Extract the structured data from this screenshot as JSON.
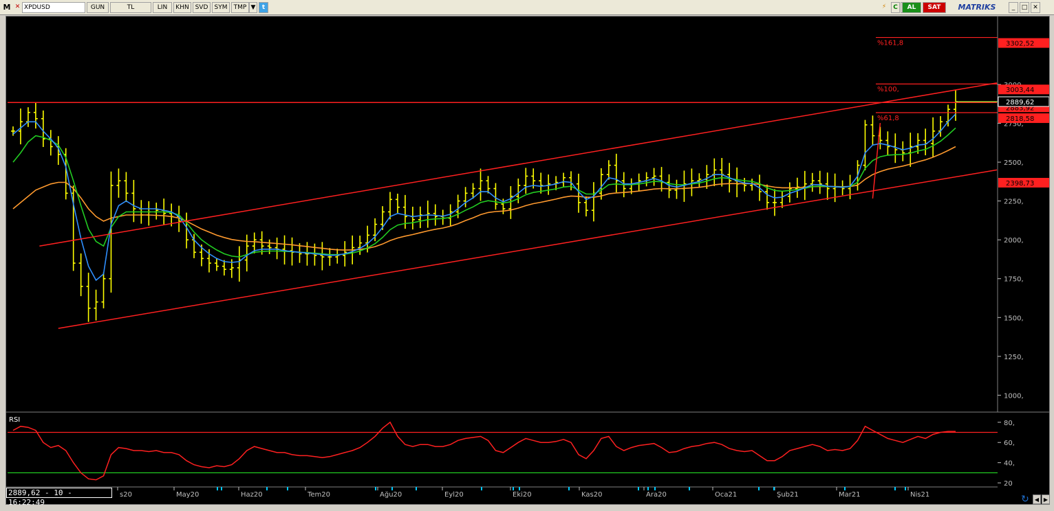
{
  "toolbar": {
    "logo": "M",
    "symbol": "XPDUSD",
    "buttons": [
      "GUN",
      "TL",
      "LIN",
      "KHN",
      "SVD",
      "SYM",
      "TMP"
    ],
    "buy_label": "AL",
    "sell_label": "SAT",
    "brand": "MATRIKS"
  },
  "chart_data": {
    "type": "line",
    "ylim": [
      900,
      3420
    ],
    "yticks": [
      "1000,",
      "1250,",
      "1500,",
      "1750,",
      "2000,",
      "2250,",
      "2500,",
      "2750,",
      "3000,"
    ],
    "ytick_values": [
      1000,
      1250,
      1500,
      1750,
      2000,
      2250,
      2500,
      2750,
      3000
    ],
    "xlabels": [
      "s20",
      "May20",
      "Haz20",
      "Tem20",
      "Ağu20",
      "Eyl20",
      "Eki20",
      "Kas20",
      "Ara20",
      "Oca21",
      "Şub21",
      "Mar21",
      "Nis21"
    ],
    "fibonacci": [
      {
        "label": "%161,8",
        "value": 3302.52,
        "value_label": "3302,52"
      },
      {
        "label": "%100,",
        "value": 3003.44,
        "value_label": "3003,44"
      },
      {
        "label": "%61,8",
        "value": 2818.58,
        "value_label": "2818,58"
      }
    ],
    "price_tags": [
      {
        "value": 2883.92,
        "label": "2883,92"
      },
      {
        "value": 2398.73,
        "label": "2398,73"
      }
    ],
    "last_price": {
      "value": 2889.62,
      "label": "2889,62"
    },
    "close": [
      2700,
      2760,
      2820,
      2780,
      2650,
      2600,
      2550,
      2300,
      1850,
      1700,
      1560,
      1600,
      1750,
      2350,
      2380,
      2300,
      2200,
      2160,
      2180,
      2190,
      2170,
      2150,
      2120,
      2000,
      1920,
      1880,
      1850,
      1830,
      1810,
      1820,
      1870,
      1960,
      2000,
      1960,
      1950,
      1940,
      1930,
      1920,
      1910,
      1910,
      1900,
      1890,
      1890,
      1900,
      1920,
      1950,
      1980,
      2030,
      2100,
      2180,
      2260,
      2210,
      2150,
      2130,
      2160,
      2170,
      2150,
      2140,
      2180,
      2250,
      2300,
      2330,
      2380,
      2330,
      2230,
      2200,
      2280,
      2350,
      2410,
      2380,
      2350,
      2360,
      2370,
      2400,
      2360,
      2240,
      2190,
      2300,
      2420,
      2480,
      2380,
      2330,
      2360,
      2380,
      2400,
      2410,
      2370,
      2320,
      2330,
      2360,
      2380,
      2390,
      2420,
      2450,
      2420,
      2380,
      2360,
      2350,
      2360,
      2310,
      2240,
      2240,
      2280,
      2330,
      2340,
      2360,
      2380,
      2360,
      2330,
      2340,
      2330,
      2350,
      2480,
      2740,
      2670,
      2640,
      2600,
      2580,
      2560,
      2600,
      2640,
      2620,
      2700,
      2760,
      2840,
      2890
    ],
    "ema_blue": [
      2680,
      2720,
      2760,
      2760,
      2700,
      2650,
      2590,
      2470,
      2230,
      2010,
      1830,
      1740,
      1780,
      2100,
      2220,
      2250,
      2220,
      2200,
      2200,
      2200,
      2190,
      2180,
      2150,
      2080,
      2000,
      1950,
      1910,
      1880,
      1860,
      1855,
      1860,
      1900,
      1930,
      1940,
      1940,
      1940,
      1930,
      1925,
      1920,
      1915,
      1910,
      1905,
      1900,
      1902,
      1910,
      1925,
      1945,
      1975,
      2020,
      2080,
      2150,
      2170,
      2160,
      2150,
      2155,
      2160,
      2158,
      2152,
      2165,
      2200,
      2240,
      2270,
      2310,
      2310,
      2270,
      2245,
      2265,
      2300,
      2340,
      2350,
      2345,
      2350,
      2360,
      2375,
      2370,
      2310,
      2260,
      2280,
      2340,
      2400,
      2390,
      2360,
      2360,
      2370,
      2380,
      2395,
      2380,
      2350,
      2340,
      2350,
      2365,
      2375,
      2395,
      2420,
      2420,
      2400,
      2380,
      2365,
      2362,
      2335,
      2290,
      2270,
      2275,
      2300,
      2315,
      2335,
      2355,
      2355,
      2345,
      2342,
      2338,
      2345,
      2410,
      2560,
      2610,
      2620,
      2610,
      2595,
      2580,
      2590,
      2610,
      2615,
      2650,
      2700,
      2760,
      2810
    ],
    "ema_green": [
      2500,
      2560,
      2630,
      2670,
      2660,
      2640,
      2610,
      2530,
      2380,
      2220,
      2070,
      1990,
      1960,
      2080,
      2150,
      2180,
      2180,
      2180,
      2180,
      2180,
      2180,
      2175,
      2160,
      2110,
      2050,
      2000,
      1965,
      1935,
      1910,
      1895,
      1890,
      1905,
      1920,
      1925,
      1928,
      1928,
      1926,
      1924,
      1920,
      1918,
      1914,
      1910,
      1906,
      1905,
      1908,
      1915,
      1928,
      1948,
      1975,
      2015,
      2065,
      2095,
      2105,
      2110,
      2120,
      2130,
      2135,
      2137,
      2145,
      2165,
      2190,
      2212,
      2240,
      2252,
      2245,
      2237,
      2245,
      2265,
      2290,
      2305,
      2312,
      2320,
      2328,
      2340,
      2345,
      2320,
      2295,
      2295,
      2320,
      2355,
      2360,
      2355,
      2355,
      2360,
      2367,
      2376,
      2374,
      2362,
      2355,
      2355,
      2360,
      2366,
      2378,
      2393,
      2400,
      2395,
      2388,
      2380,
      2376,
      2362,
      2335,
      2318,
      2313,
      2318,
      2324,
      2332,
      2342,
      2346,
      2343,
      2342,
      2340,
      2343,
      2370,
      2460,
      2510,
      2535,
      2545,
      2548,
      2550,
      2558,
      2572,
      2582,
      2605,
      2635,
      2675,
      2720
    ],
    "ema_orange": [
      2200,
      2240,
      2280,
      2320,
      2340,
      2360,
      2370,
      2370,
      2330,
      2270,
      2200,
      2150,
      2120,
      2140,
      2150,
      2160,
      2160,
      2160,
      2160,
      2158,
      2155,
      2150,
      2140,
      2120,
      2095,
      2070,
      2050,
      2030,
      2015,
      2002,
      1995,
      1990,
      1988,
      1984,
      1980,
      1976,
      1972,
      1968,
      1962,
      1957,
      1951,
      1946,
      1940,
      1936,
      1934,
      1935,
      1938,
      1945,
      1956,
      1973,
      1995,
      2012,
      2024,
      2034,
      2046,
      2058,
      2068,
      2076,
      2088,
      2104,
      2124,
      2142,
      2162,
      2176,
      2182,
      2185,
      2192,
      2204,
      2220,
      2233,
      2242,
      2252,
      2262,
      2274,
      2282,
      2280,
      2274,
      2274,
      2282,
      2296,
      2302,
      2305,
      2309,
      2314,
      2320,
      2327,
      2330,
      2329,
      2329,
      2331,
      2334,
      2338,
      2345,
      2354,
      2360,
      2362,
      2362,
      2361,
      2361,
      2357,
      2347,
      2339,
      2335,
      2335,
      2336,
      2338,
      2342,
      2344,
      2343,
      2343,
      2342,
      2343,
      2352,
      2390,
      2420,
      2440,
      2455,
      2465,
      2475,
      2487,
      2502,
      2515,
      2532,
      2552,
      2575,
      2600
    ],
    "rsi": {
      "label": "RSI",
      "yticks": [
        "20",
        "40,",
        "60,",
        "80,"
      ],
      "ytick_values": [
        20,
        40,
        60,
        80
      ],
      "ylim": [
        18,
        86
      ],
      "overbought": 70,
      "oversold": 30,
      "values": [
        72,
        76,
        75,
        72,
        60,
        55,
        57,
        52,
        40,
        30,
        24,
        23,
        27,
        48,
        55,
        54,
        52,
        52,
        51,
        52,
        50,
        50,
        48,
        42,
        38,
        36,
        35,
        37,
        36,
        38,
        44,
        52,
        56,
        54,
        52,
        50,
        50,
        48,
        47,
        47,
        46,
        45,
        46,
        48,
        50,
        52,
        55,
        60,
        66,
        74,
        80,
        66,
        58,
        56,
        58,
        58,
        56,
        56,
        58,
        62,
        64,
        65,
        66,
        62,
        52,
        50,
        55,
        60,
        64,
        62,
        60,
        60,
        61,
        63,
        60,
        48,
        44,
        52,
        64,
        66,
        56,
        52,
        55,
        57,
        58,
        59,
        55,
        50,
        51,
        54,
        56,
        57,
        59,
        60,
        58,
        54,
        52,
        51,
        52,
        47,
        42,
        42,
        46,
        52,
        54,
        56,
        58,
        56,
        52,
        53,
        52,
        54,
        62,
        76,
        72,
        68,
        64,
        62,
        60,
        63,
        66,
        64,
        68,
        70,
        71,
        71
      ]
    }
  },
  "status": {
    "text": "2889,62 - 10 - 16:22:49"
  }
}
